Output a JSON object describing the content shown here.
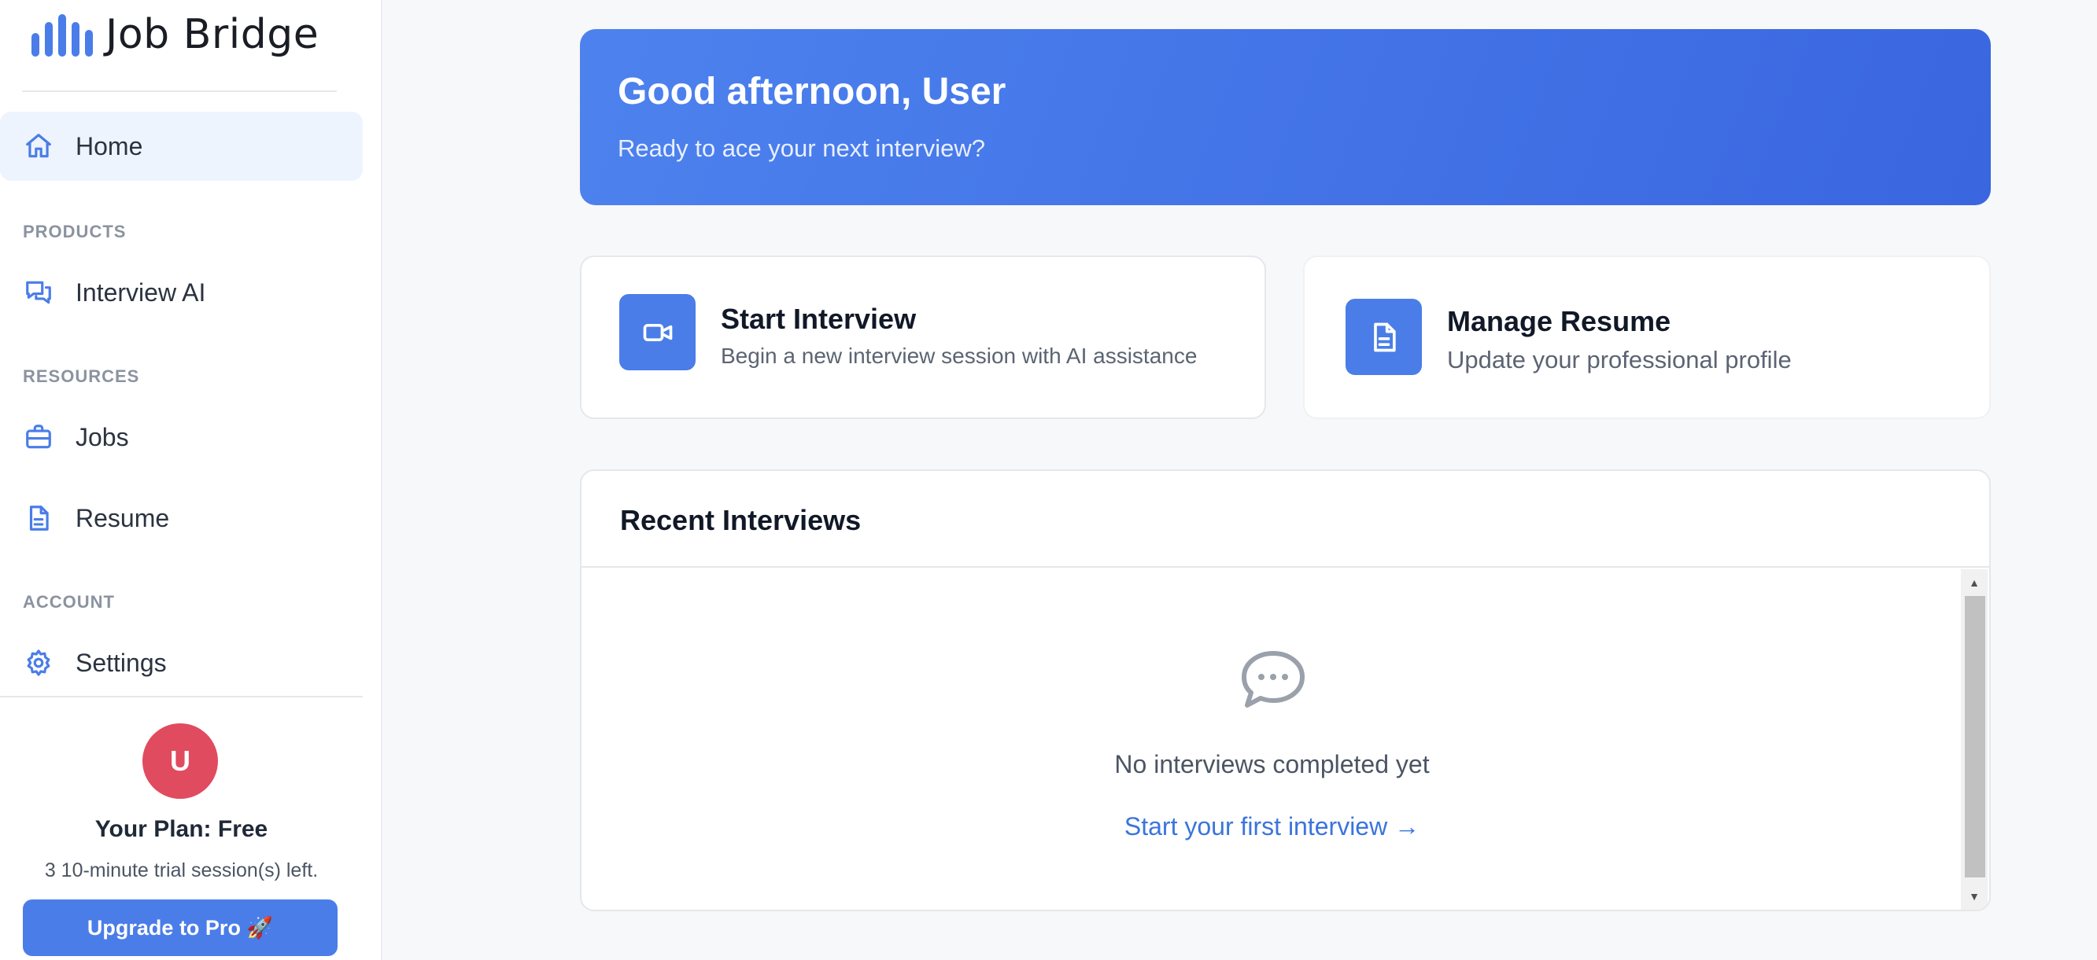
{
  "app": {
    "name": "Job Bridge"
  },
  "sidebar": {
    "home": "Home",
    "sections": [
      {
        "label": "PRODUCTS",
        "items": [
          "Interview AI"
        ]
      },
      {
        "label": "RESOURCES",
        "items": [
          "Jobs",
          "Resume"
        ]
      },
      {
        "label": "ACCOUNT",
        "items": [
          "Settings"
        ]
      }
    ],
    "user": {
      "avatar_initial": "U",
      "plan_title": "Your Plan: Free",
      "plan_detail": "3 10-minute trial session(s) left.",
      "upgrade_label": "Upgrade to Pro 🚀"
    }
  },
  "hero": {
    "title": "Good afternoon, User",
    "subtitle": "Ready to ace your next interview?"
  },
  "cards": [
    {
      "title": "Start Interview",
      "subtitle": "Begin a new interview session with AI assistance",
      "icon": "video-icon"
    },
    {
      "title": "Manage Resume",
      "subtitle": "Update your professional profile",
      "icon": "document-icon"
    }
  ],
  "recent": {
    "title": "Recent Interviews",
    "empty_text": "No interviews completed yet",
    "empty_link": "Start your first interview →"
  },
  "colors": {
    "accent": "#4a7de8",
    "avatar": "#e14b5f"
  }
}
